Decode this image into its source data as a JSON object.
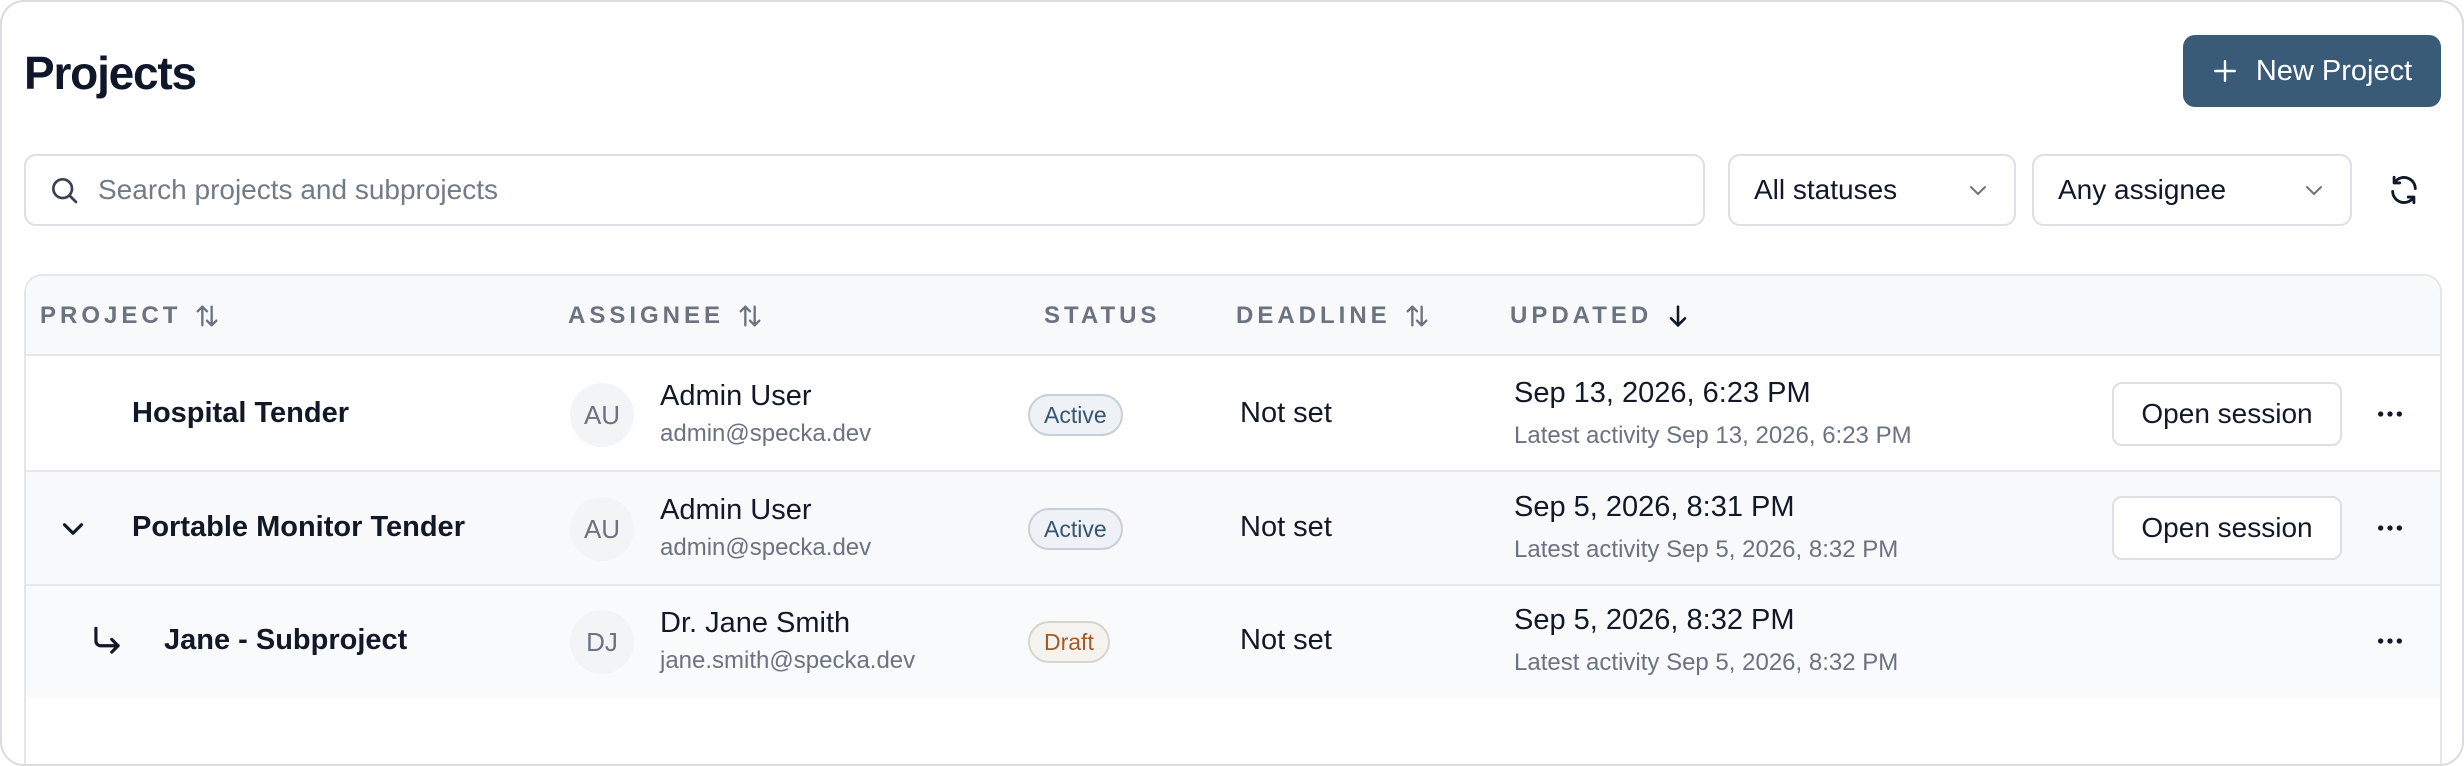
{
  "header": {
    "title": "Projects",
    "new_project_label": "New Project"
  },
  "filters": {
    "search_placeholder": "Search projects and subprojects",
    "status_value": "All statuses",
    "assignee_value": "Any assignee"
  },
  "table": {
    "columns": {
      "project": "PROJECT",
      "assignee": "ASSIGNEE",
      "status": "STATUS",
      "deadline": "DEADLINE",
      "updated": "UPDATED"
    },
    "rows": [
      {
        "name": "Hospital Tender",
        "initials": "AU",
        "assignee_name": "Admin User",
        "assignee_email": "admin@specka.dev",
        "status": "Active",
        "deadline": "Not set",
        "updated": "Sep 13, 2026, 6:23 PM",
        "latest_activity": "Latest activity Sep 13, 2026, 6:23 PM",
        "action_label": "Open session"
      },
      {
        "name": "Portable Monitor Tender",
        "initials": "AU",
        "assignee_name": "Admin User",
        "assignee_email": "admin@specka.dev",
        "status": "Active",
        "deadline": "Not set",
        "updated": "Sep 5, 2026, 8:31 PM",
        "latest_activity": "Latest activity Sep 5, 2026, 8:32 PM",
        "action_label": "Open session"
      },
      {
        "name": "Jane - Subproject",
        "initials": "DJ",
        "assignee_name": "Dr. Jane Smith",
        "assignee_email": "jane.smith@specka.dev",
        "status": "Draft",
        "deadline": "Not set",
        "updated": "Sep 5, 2026, 8:32 PM",
        "latest_activity": "Latest activity Sep 5, 2026, 8:32 PM"
      }
    ]
  },
  "colors": {
    "primary": "#395b78",
    "active_badge_text": "#385570",
    "draft_badge_text": "#a45a22"
  },
  "icons": [
    "plus-icon",
    "search-icon",
    "chevron-down-icon",
    "refresh-icon",
    "sort-icon",
    "arrow-down-icon",
    "subproject-arrow-icon",
    "more-icon"
  ]
}
